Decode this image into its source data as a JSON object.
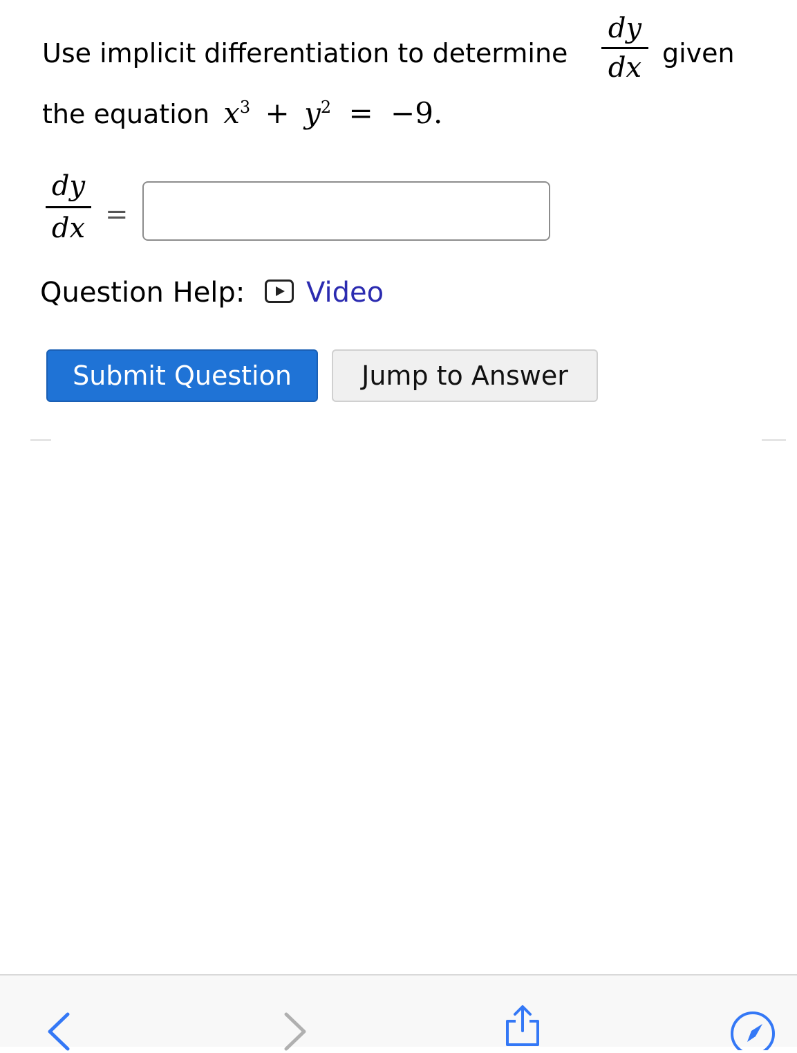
{
  "question": {
    "line1_text": "Use implicit differentiation to determine",
    "given_word": "given",
    "line2_text": "the equation",
    "derivative": {
      "numerator": "dy",
      "denominator": "dx"
    },
    "equation": {
      "x": "x",
      "x_exp": "3",
      "plus": "+",
      "y": "y",
      "y_exp": "2",
      "equals": "=",
      "rhs": "−9."
    }
  },
  "answer": {
    "lhs": {
      "numerator": "dy",
      "denominator": "dx"
    },
    "equals": "=",
    "input_value": ""
  },
  "help": {
    "label": "Question Help:",
    "video_label": "Video"
  },
  "buttons": {
    "submit": "Submit Question",
    "jump": "Jump to Answer"
  },
  "colors": {
    "primary": "#1f73d6",
    "link": "#2b2bb0"
  },
  "toolbar": {
    "icons": [
      "back-arrow-icon",
      "forward-arrow-icon",
      "share-icon",
      "compass-icon"
    ]
  }
}
